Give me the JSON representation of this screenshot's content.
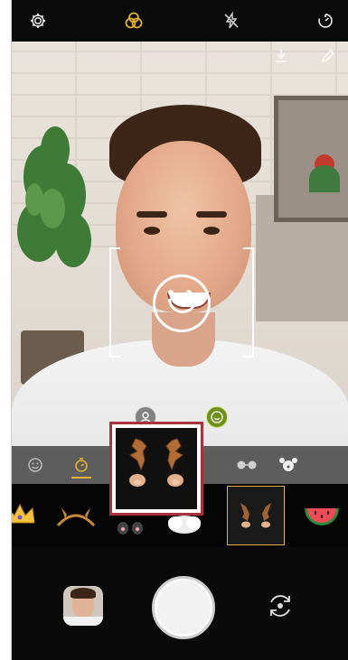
{
  "top_bar": {
    "icons": [
      "settings-icon",
      "filter-icon",
      "flash-off-icon",
      "timer-icon"
    ]
  },
  "viewfinder": {
    "overlay_icons": [
      "download-icon",
      "edit-icon"
    ],
    "face_guide": "smiley-face-icon"
  },
  "modes": {
    "tabs": [
      "face-sticker-icon",
      "timer-mode-icon",
      "deer-sticker",
      "glasses-sticker",
      "animal-sticker"
    ]
  },
  "stickers": {
    "items": [
      "crown",
      "headband",
      "ears",
      "beard",
      "deer-antlers",
      "watermelon"
    ],
    "selected": "deer-antlers"
  },
  "bottom_bar": {
    "icons": [
      "gallery-thumbnail",
      "shutter-button",
      "switch-camera-icon"
    ]
  },
  "colors": {
    "accent": "#e1b12b",
    "highlight": "#a8323d"
  }
}
